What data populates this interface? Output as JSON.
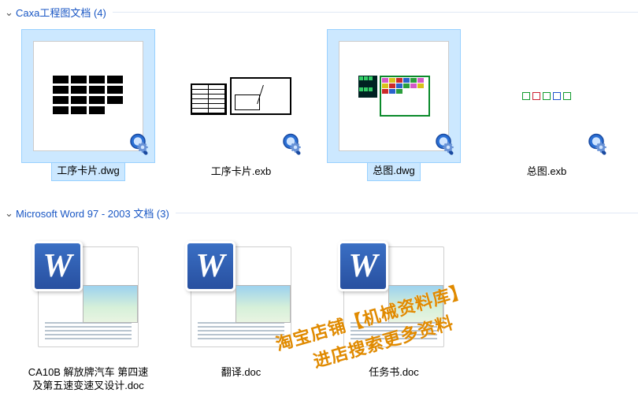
{
  "groups": [
    {
      "id": "caxa",
      "title": "Caxa工程图文档 (4)",
      "items": [
        {
          "filename": "工序卡片.dwg",
          "selected": true,
          "thumb": "dwg1"
        },
        {
          "filename": "工序卡片.exb",
          "selected": false,
          "thumb": "dwg2"
        },
        {
          "filename": "总图.dwg",
          "selected": true,
          "thumb": "dwg3"
        },
        {
          "filename": "总图.exb",
          "selected": false,
          "thumb": "dwg4"
        }
      ]
    },
    {
      "id": "word",
      "title": "Microsoft Word 97 - 2003 文档 (3)",
      "items": [
        {
          "filename": "CA10B 解放牌汽车  第四速及第五速变速叉设计.doc",
          "selected": false,
          "thumb": "doc"
        },
        {
          "filename": "翻译.doc",
          "selected": false,
          "thumb": "doc"
        },
        {
          "filename": "任务书.doc",
          "selected": false,
          "thumb": "doc"
        }
      ]
    }
  ],
  "overlay_icon": "magnifier-gear-icon",
  "watermark": {
    "line1": "淘宝店铺【机械资料库】",
    "line2": "进店搜索更多资料"
  },
  "chevron_glyph": "⌄"
}
